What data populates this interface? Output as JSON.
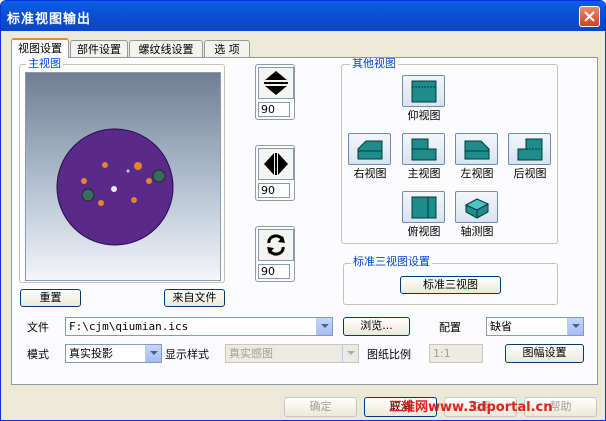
{
  "window": {
    "title": "标准视图输出"
  },
  "tabs": [
    {
      "label": "视图设置"
    },
    {
      "label": "部件设置"
    },
    {
      "label": "螺纹线设置"
    },
    {
      "label": "选  项"
    }
  ],
  "main_view": {
    "label": "主视图",
    "reset_label": "重置",
    "from_file_label": "来自文件"
  },
  "controls": {
    "flip_value": "90",
    "horizontal_value": "90",
    "rotate_value": "90"
  },
  "other_views": {
    "label": "其他视图",
    "items": [
      {
        "label": "仰视图"
      },
      {
        "label": "右视图"
      },
      {
        "label": "主视图"
      },
      {
        "label": "左视图"
      },
      {
        "label": "后视图"
      },
      {
        "label": "俯视图"
      },
      {
        "label": "轴测图"
      }
    ]
  },
  "standard_three": {
    "label": "标准三视图设置",
    "button_label": "标准三视图"
  },
  "file_row": {
    "file_label": "文件",
    "file_value": "F:\\cjm\\qiumian.ics",
    "browse_label": "浏览...",
    "config_label": "配置",
    "config_value": "缺省"
  },
  "mode_row": {
    "mode_label": "模式",
    "mode_value": "真实投影",
    "display_label": "显示样式",
    "display_value": "真实感图",
    "scale_label": "图纸比例",
    "scale_value": "1:1",
    "frame_label": "图幅设置"
  },
  "footer": {
    "ok_label": "确定",
    "cancel_label": "取消",
    "apply_label": "应用",
    "help_label": "帮助",
    "watermark": "三维网www.3dportal.cn"
  },
  "colors": {
    "titlebar": "#0a5fe6",
    "part_purple": "#5a2a8a",
    "group_label": "#0046d5"
  }
}
